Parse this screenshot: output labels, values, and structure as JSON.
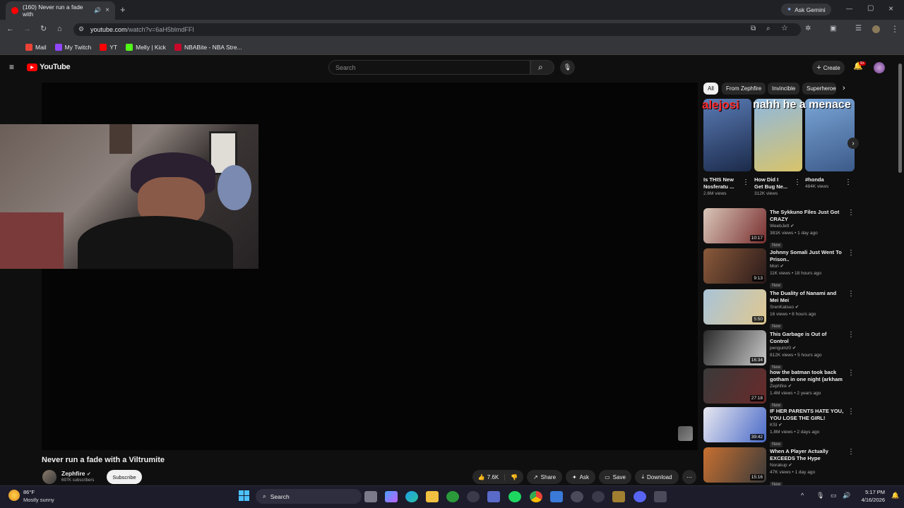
{
  "browser": {
    "tab_title": "(160) Never run a fade with",
    "new_tab": "+",
    "ask_gemini": "Ask Gemini",
    "url_domain": "youtube.com",
    "url_path": "/watch?v=6aH5blmdFFI",
    "bookmarks": [
      {
        "label": "Mail",
        "color": "#ea4335"
      },
      {
        "label": "My Twitch",
        "color": "#9146ff"
      },
      {
        "label": "YT",
        "color": "#ff0000"
      },
      {
        "label": "Melly | Kick",
        "color": "#53fc18"
      },
      {
        "label": "NBABite - NBA Stre...",
        "color": "#c9082a"
      }
    ]
  },
  "youtube": {
    "logo": "YouTube",
    "search_placeholder": "Search",
    "create": "Create",
    "notif_count": "9+"
  },
  "video": {
    "title": "Never run a fade with a Viltrumite",
    "channel": "Zephfire",
    "subscribers": "697K subscribers",
    "subscribe": "Subscribe",
    "likes": "7.6K",
    "share": "Share",
    "ask": "Ask",
    "save": "Save",
    "download": "Download"
  },
  "overlay": {
    "name": "alejosi",
    "text": "nahh he a menace"
  },
  "chips": [
    "All",
    "From Zephfire",
    "Invincible",
    "Superheroe"
  ],
  "shorts": [
    {
      "title1": "Is THIS New",
      "title2": "Nosferatu ...",
      "views": "2.6M views",
      "bg": "linear-gradient(160deg,#5a7bb5,#1b2a4a)"
    },
    {
      "title1": "How Did I",
      "title2": "Get Bug Ne...",
      "views": "312K views",
      "bg": "linear-gradient(160deg,#8fb8e0,#d8c46a)"
    },
    {
      "title1": "#honda",
      "title2": "",
      "views": "484K views",
      "bg": "linear-gradient(160deg,#7aa6d6,#3c5a8a)"
    }
  ],
  "recommended": [
    {
      "title": "The Sykkuno Files Just Got CRAZY",
      "channel": "WeebJett",
      "meta": "381K views • 1 day ago",
      "duration": "10:17",
      "bg": "linear-gradient(120deg,#d9c6b9,#7a3030)"
    },
    {
      "title": "Johnny Somali Just Went To Prison..",
      "channel": "Mori",
      "meta": "11K views • 18 hours ago",
      "duration": "9:13",
      "bg": "linear-gradient(120deg,#8a5a3a,#2a1a1a)"
    },
    {
      "title": "The Duality of Nanami and Mei Mei",
      "channel": "SrenKatsuo",
      "meta": "16 views • 8 hours ago",
      "duration": "5:50",
      "bg": "linear-gradient(120deg,#a9c4d8,#e0c890)"
    },
    {
      "title": "This Garbage is Out of Control",
      "channel": "penguinz0",
      "meta": "812K views • 5 hours ago",
      "duration": "16:34",
      "bg": "linear-gradient(120deg,#2a2a2a,#c9c9c9)"
    },
    {
      "title": "how the batman took back gotham in one night (arkham ...",
      "channel": "Zephfire",
      "meta": "1.4M views • 2 years ago",
      "duration": "27:18",
      "bg": "linear-gradient(120deg,#3a3a3a,#6a2a2a)"
    },
    {
      "title": "IF HER PARENTS HATE YOU, YOU LOSE THE GIRL!",
      "channel": "KSI",
      "meta": "1.8M views • 2 days ago",
      "duration": "39:42",
      "bg": "linear-gradient(120deg,#e8e8f0,#4a6ac8)"
    },
    {
      "title": "When A Player Actually EXCEEDS The Hype",
      "channel": "Norakup",
      "meta": "47K views • 1 day ago",
      "duration": "15:16",
      "bg": "linear-gradient(120deg,#c87030,#3a3a3a)"
    }
  ],
  "new_badge": "New",
  "taskbar": {
    "temp": "86°F",
    "weather": "Mostly sunny",
    "search": "Search",
    "time": "5:17 PM",
    "date": "4/16/2026"
  }
}
